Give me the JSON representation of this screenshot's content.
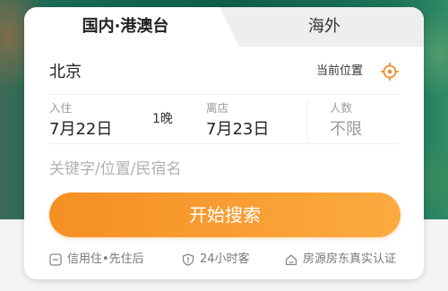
{
  "tabs": [
    {
      "label": "国内·港澳台",
      "active": true
    },
    {
      "label": "海外",
      "active": false
    }
  ],
  "destination": {
    "city": "北京",
    "current_location_label": "当前位置",
    "current_location_icon": "locate-icon"
  },
  "dates": {
    "checkin_label": "入住",
    "checkin_value": "7月22日",
    "nights": "1晚",
    "checkout_label": "离店",
    "checkout_value": "7月23日"
  },
  "guests": {
    "label": "人数",
    "value": "不限"
  },
  "keyword": {
    "placeholder": "关键字/位置/民宿名"
  },
  "search_button": {
    "label": "开始搜索"
  },
  "features": [
    {
      "icon": "minus-square-icon",
      "label": "信用住•先住后"
    },
    {
      "icon": "shield-icon",
      "label": "24小时客"
    },
    {
      "icon": "house-icon",
      "label": "房源房东真实认证"
    }
  ],
  "colors": {
    "accent": "#f5892a",
    "button_start": "#f58f24",
    "button_end": "#fcaa40",
    "text_primary": "#222222",
    "text_secondary": "#999999",
    "tab_inactive_bg": "#eeeeee"
  }
}
